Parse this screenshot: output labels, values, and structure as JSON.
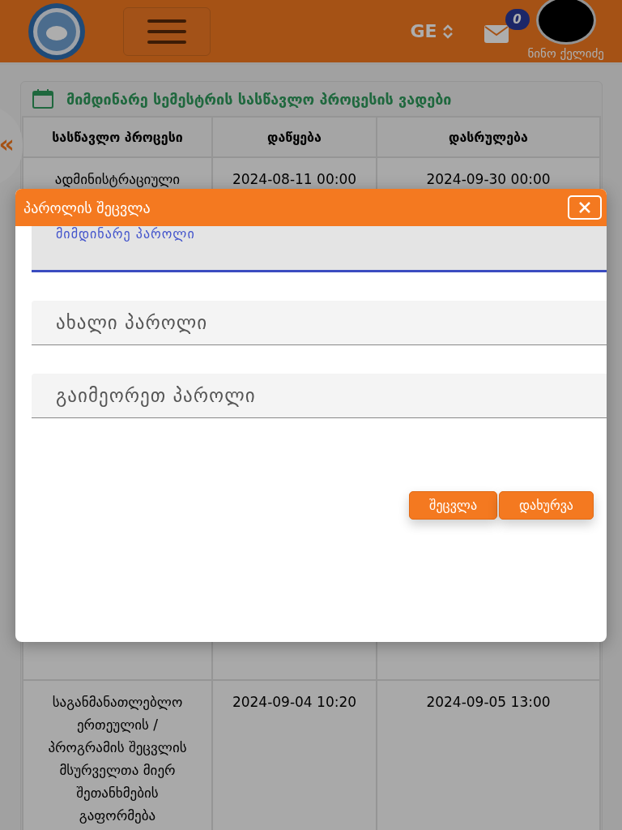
{
  "header": {
    "language": "GE",
    "unread_count": "0",
    "user_name": "ნინო ქელიძე"
  },
  "sidebar_toggle": "«",
  "schedule_card": {
    "title": "მიმდინარე სემესტრის სასწავლო პროცესის ვადები",
    "columns": [
      "სასწავლო პროცესი",
      "დაწყება",
      "დასრულება"
    ],
    "rows": [
      {
        "kind": "text",
        "cells": [
          "ადმინისტრაციული",
          "2024-08-11 00:00",
          "2024-09-30 00:00"
        ]
      },
      {
        "kind": "hidden",
        "cells": []
      },
      {
        "kind": "text",
        "cells": [
          "საგანმანათლებლო ერთეულის / პროგრამის შეცვლის მსურველთა მიერ შეთანხმების გაფორმება",
          "2024-09-04 10:20",
          "2024-09-05 13:00"
        ]
      }
    ]
  },
  "modal": {
    "title": "პაროლის შეცვლა",
    "fields": [
      {
        "label": "მიმდინარე პაროლი",
        "focused": true
      },
      {
        "label": "ახალი პაროლი",
        "focused": false
      },
      {
        "label": "გაიმეორეთ პაროლი",
        "focused": false
      }
    ],
    "buttons": [
      "შეცვლა",
      "დახურვა"
    ]
  }
}
